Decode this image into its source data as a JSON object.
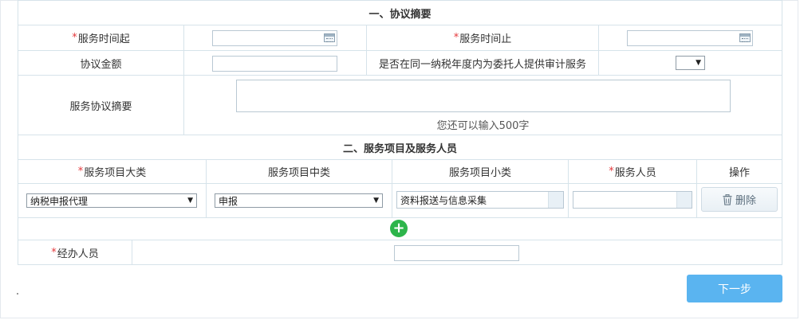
{
  "section1": {
    "title": "一、协议摘要",
    "service_start": {
      "required": "*",
      "label": "服务时间起",
      "value": ""
    },
    "service_end": {
      "required": "*",
      "label": "服务时间止",
      "value": ""
    },
    "amount": {
      "label": "协议金额",
      "value": ""
    },
    "audit_question": {
      "label": "是否在同一纳税年度内为委托人提供审计服务",
      "selected": ""
    },
    "summary": {
      "label": "服务协议摘要",
      "value": "",
      "hint": "您还可以输入500字"
    }
  },
  "section2": {
    "title": "二、服务项目及服务人员",
    "headers": [
      {
        "required": "*",
        "label": "服务项目大类"
      },
      {
        "required": "",
        "label": "服务项目中类"
      },
      {
        "required": "",
        "label": "服务项目小类"
      },
      {
        "required": "*",
        "label": "服务人员"
      },
      {
        "required": "",
        "label": "操作"
      }
    ],
    "row": {
      "category_major": "纳税申报代理",
      "category_mid": "申报",
      "category_minor": "资料报送与信息采集",
      "personnel": "",
      "delete_label": "删除"
    },
    "add_symbol": "+"
  },
  "handler": {
    "required": "*",
    "label": "经办人员",
    "value": ""
  },
  "next_label": "下一步",
  "colors": {
    "required": "#e4393c",
    "border": "#d6e3ea",
    "add": "#2db54b",
    "next": "#5ab4f0"
  },
  "icons": {
    "calendar": "calendar-icon",
    "dropdown": "dropdown-arrow-icon",
    "trash": "trash-icon",
    "plus": "plus-icon"
  }
}
